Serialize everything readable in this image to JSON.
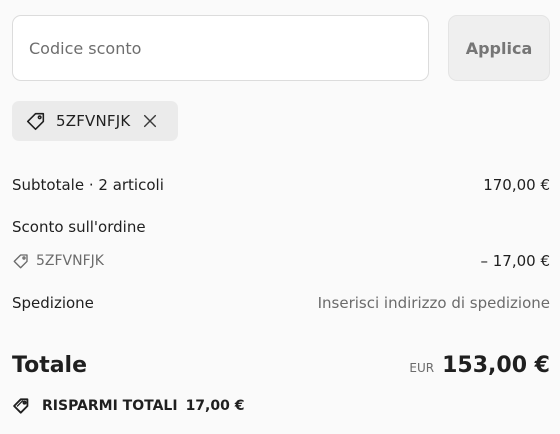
{
  "discount": {
    "placeholder": "Codice sconto",
    "value": "",
    "apply_label": "Applica"
  },
  "applied_code": {
    "code": "5ZFVNFJK",
    "icon": "tag-icon",
    "remove_icon": "close-icon"
  },
  "summary": {
    "subtotal_label": "Subtotale · 2 articoli",
    "subtotal_value": "170,00 €",
    "discount_label": "Sconto sull'ordine",
    "discount_code": "5ZFVNFJK",
    "discount_value": "– 17,00 €",
    "shipping_label": "Spedizione",
    "shipping_value": "Inserisci indirizzo di spedizione",
    "total_label": "Totale",
    "currency": "EUR",
    "total_value": "153,00 €",
    "savings_label": "RISPARMI TOTALI",
    "savings_value": "17,00 €"
  },
  "colors": {
    "background": "#fafafa",
    "text": "#1f1f1f",
    "muted": "#6b6b6b",
    "chip": "#ebebeb",
    "button": "#efefef"
  }
}
